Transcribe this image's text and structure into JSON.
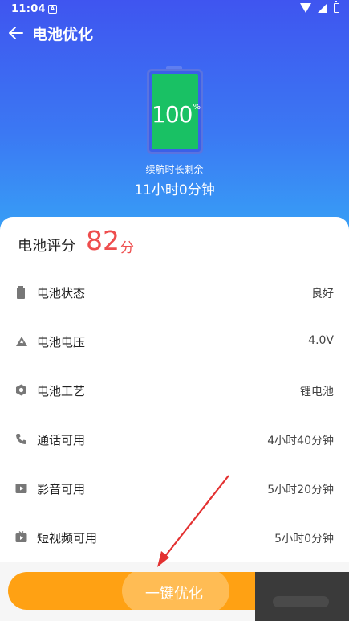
{
  "status_bar": {
    "time": "11:04",
    "notification": "A"
  },
  "app": {
    "title": "电池优化"
  },
  "battery": {
    "level_text": "100",
    "level_unit": "%",
    "level_fraction": 1.0
  },
  "remaining": {
    "label": "续航时长剩余",
    "value": "11小时0分钟"
  },
  "score": {
    "label": "电池评分",
    "value": "82",
    "unit": "分"
  },
  "items": [
    {
      "label": "电池状态",
      "value": "良好",
      "icon": "battery-icon"
    },
    {
      "label": "电池电压",
      "value": "4.0V",
      "icon": "voltage-icon"
    },
    {
      "label": "电池工艺",
      "value": "锂电池",
      "icon": "technology-icon"
    },
    {
      "label": "通话可用",
      "value": "4小时40分钟",
      "icon": "phone-icon"
    },
    {
      "label": "影音可用",
      "value": "5小时20分钟",
      "icon": "video-icon"
    },
    {
      "label": "短视频可用",
      "value": "5小时0分钟",
      "icon": "short-video-icon"
    }
  ],
  "action": {
    "label": "一键优化"
  },
  "colors": {
    "accent": "#ffa113",
    "score": "#ee4d4d",
    "battery_fill": "#19c164",
    "header_top": "#3f55f0",
    "header_bottom": "#37a3f6"
  }
}
